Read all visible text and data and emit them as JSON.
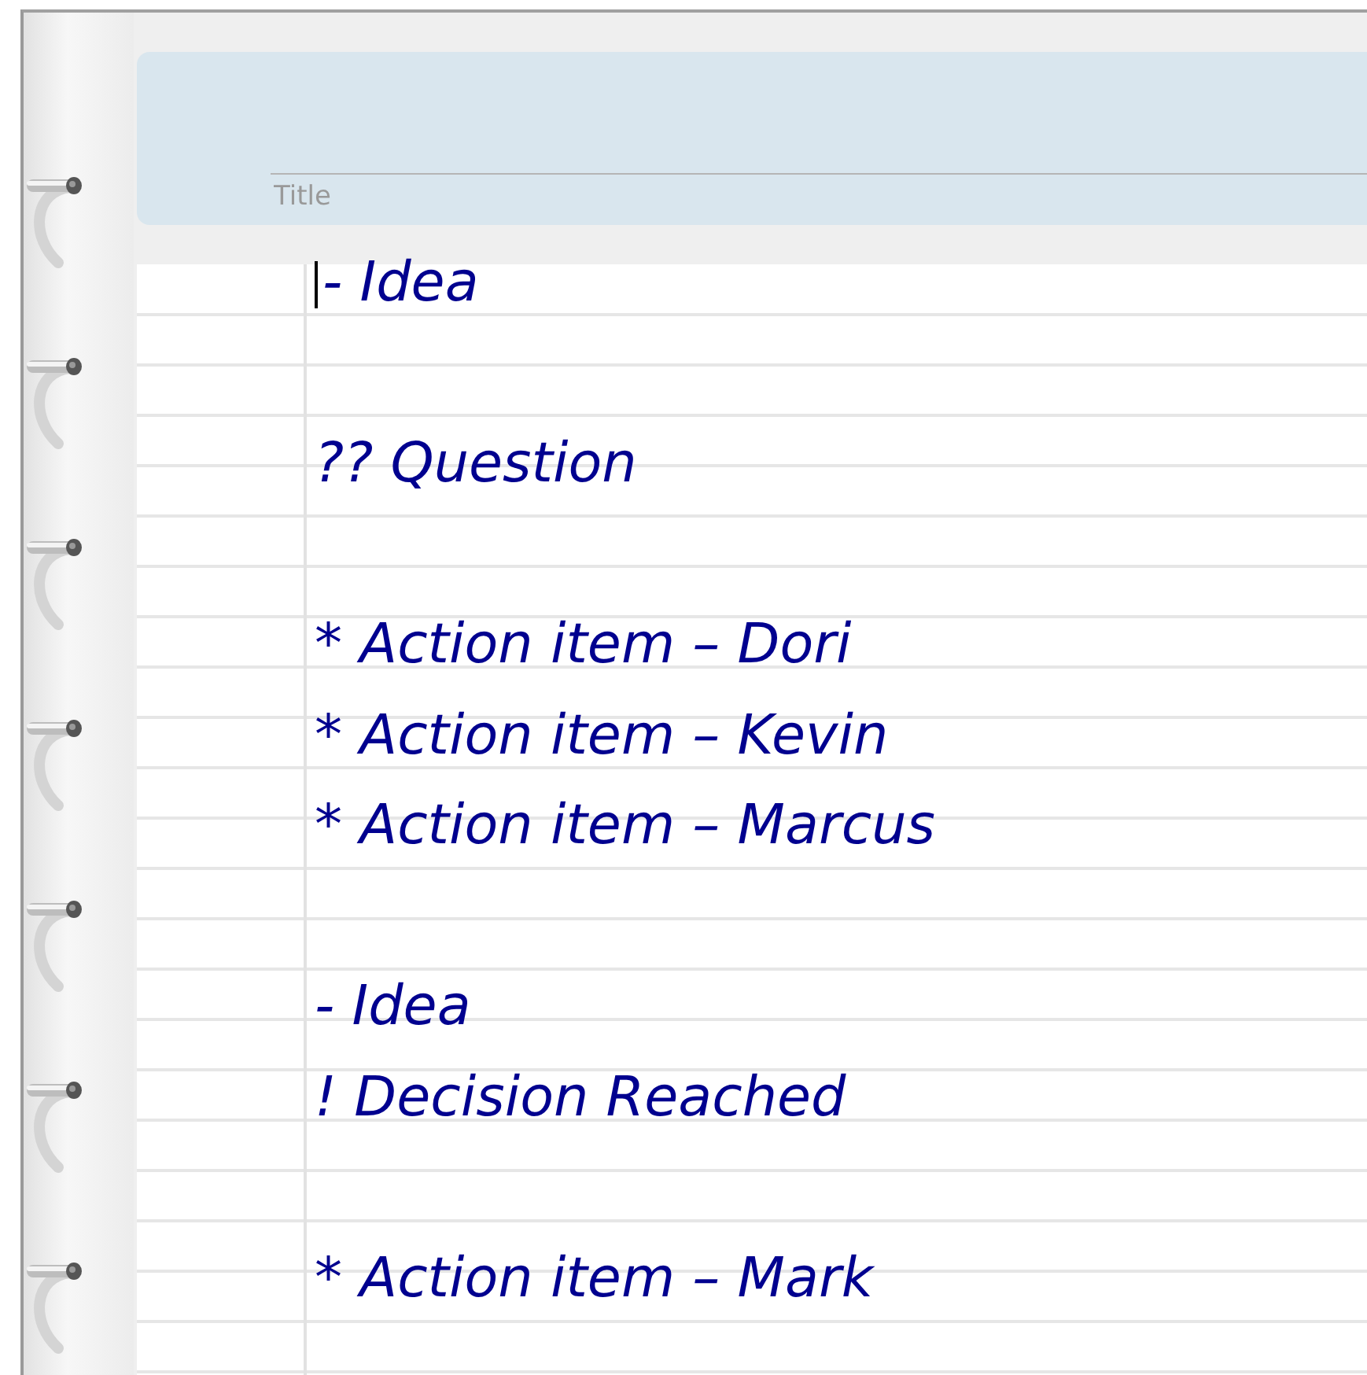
{
  "title_field": {
    "placeholder": "Title"
  },
  "lines": [
    {
      "kind": "note",
      "text": "- Idea",
      "cursor": true
    },
    {
      "kind": "blank"
    },
    {
      "kind": "note",
      "text": "?? Question",
      "cursor": false
    },
    {
      "kind": "blank"
    },
    {
      "kind": "note",
      "text": "* Action item – Dori",
      "cursor": false
    },
    {
      "kind": "note",
      "text": "* Action item – Kevin",
      "cursor": false
    },
    {
      "kind": "note",
      "text": "* Action item – Marcus",
      "cursor": false
    },
    {
      "kind": "blank"
    },
    {
      "kind": "note",
      "text": "- Idea",
      "cursor": false
    },
    {
      "kind": "note",
      "text": "! Decision Reached",
      "cursor": false
    },
    {
      "kind": "blank"
    },
    {
      "kind": "note",
      "text": "* Action item – Mark",
      "cursor": false
    }
  ]
}
